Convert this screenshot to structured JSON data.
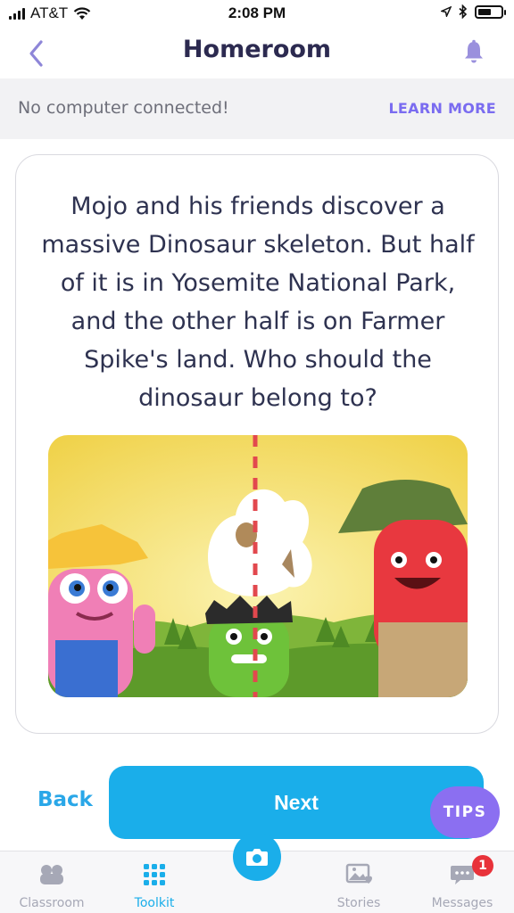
{
  "status_bar": {
    "carrier": "AT&T",
    "time": "2:08 PM",
    "battery_level": 0.6
  },
  "nav": {
    "title": "Homeroom",
    "back_icon": "chevron-left-icon",
    "notification_icon": "bell-icon"
  },
  "banner": {
    "message": "No computer connected!",
    "action": "LEARN MORE"
  },
  "story": {
    "text": "Mojo and his friends discover a massive Dinosaur skeleton. But half of it is in Yosemite National Park, and the other half is on Farmer Spike's land. Who should the dinosaur belong to?"
  },
  "actions": {
    "back": "Back",
    "next": "Next",
    "tips": "TIPS"
  },
  "tabbar": {
    "tabs": [
      {
        "label": "Classroom",
        "icon": "classroom-icon"
      },
      {
        "label": "Toolkit",
        "icon": "grid-icon",
        "active": true
      },
      {
        "label": "",
        "icon": "camera-icon"
      },
      {
        "label": "Stories",
        "icon": "stories-icon"
      },
      {
        "label": "Messages",
        "icon": "messages-icon"
      }
    ],
    "messages_badge": "1"
  },
  "colors": {
    "accent": "#1aaeea",
    "purple": "#7a6cf0",
    "title": "#2c2a50",
    "badge": "#e8323a"
  }
}
